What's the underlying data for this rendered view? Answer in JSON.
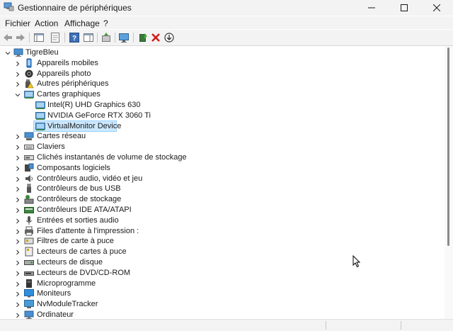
{
  "window": {
    "title": "Gestionnaire de périphériques"
  },
  "menu": [
    "Fichier",
    "Action",
    "Affichage",
    "?"
  ],
  "tree": {
    "root": "TigreBleu",
    "items": [
      {
        "label": "Appareils mobiles",
        "icon": "phone-icon",
        "expanded": false
      },
      {
        "label": "Appareils photo",
        "icon": "camera-icon",
        "expanded": false
      },
      {
        "label": "Autres périphériques",
        "icon": "warning-device-icon",
        "expanded": false
      },
      {
        "label": "Cartes graphiques",
        "icon": "display-adapter-icon",
        "expanded": true
      },
      {
        "label": "Intel(R) UHD Graphics 630",
        "icon": "display-adapter-icon",
        "child": true
      },
      {
        "label": "NVIDIA GeForce RTX 3060 Ti",
        "icon": "display-adapter-icon",
        "child": true
      },
      {
        "label": "VirtualMonitor Device",
        "icon": "display-adapter-icon",
        "child": true,
        "selected": true
      },
      {
        "label": "Cartes réseau",
        "icon": "network-icon",
        "expanded": false
      },
      {
        "label": "Claviers",
        "icon": "keyboard-icon",
        "expanded": false
      },
      {
        "label": "Clichés instantanés de volume de stockage",
        "icon": "storage-icon",
        "expanded": false
      },
      {
        "label": "Composants logiciels",
        "icon": "software-component-icon",
        "expanded": false
      },
      {
        "label": "Contrôleurs audio, vidéo et jeu",
        "icon": "speaker-icon",
        "expanded": false
      },
      {
        "label": "Contrôleurs de bus USB",
        "icon": "usb-icon",
        "expanded": false
      },
      {
        "label": "Contrôleurs de stockage",
        "icon": "storage-controller-icon",
        "expanded": false
      },
      {
        "label": "Contrôleurs IDE ATA/ATAPI",
        "icon": "ide-icon",
        "expanded": false
      },
      {
        "label": "Entrées et sorties audio",
        "icon": "audio-io-icon",
        "expanded": false
      },
      {
        "label": "Files d'attente à l'impression :",
        "icon": "printer-icon",
        "expanded": false
      },
      {
        "label": "Filtres de carte à puce",
        "icon": "smartcard-filter-icon",
        "expanded": false
      },
      {
        "label": "Lecteurs de cartes à puce",
        "icon": "smartcard-reader-icon",
        "expanded": false
      },
      {
        "label": "Lecteurs de disque",
        "icon": "disk-icon",
        "expanded": false
      },
      {
        "label": "Lecteurs de DVD/CD-ROM",
        "icon": "dvd-icon",
        "expanded": false
      },
      {
        "label": "Microprogramme",
        "icon": "firmware-icon",
        "expanded": false
      },
      {
        "label": "Moniteurs",
        "icon": "monitor-icon",
        "expanded": false
      },
      {
        "label": "NvModuleTracker",
        "icon": "module-icon",
        "expanded": false
      },
      {
        "label": "Ordinateur",
        "icon": "computer-icon",
        "expanded": false
      }
    ]
  },
  "colors": {
    "selection_bg": "#cce8ff",
    "selection_border": "#99d1ff",
    "chrome_bg": "#f3f3f3"
  }
}
